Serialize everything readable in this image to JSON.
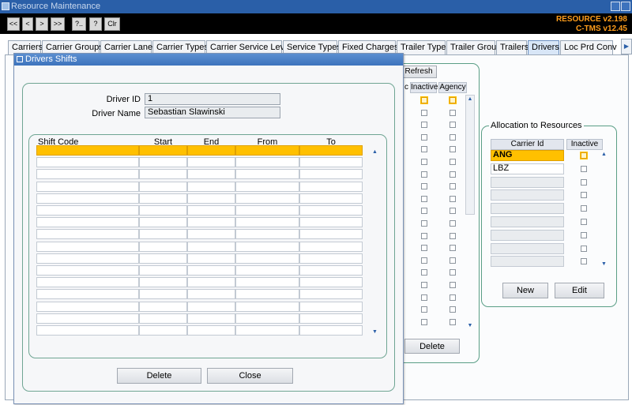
{
  "window": {
    "title": "Resource Maintenance"
  },
  "toolbar": {
    "buttons": [
      {
        "label": "<<",
        "name": "first-record-button"
      },
      {
        "label": "<",
        "name": "previous-record-button"
      },
      {
        "label": ">",
        "name": "next-record-button"
      },
      {
        "label": ">>",
        "name": "last-record-button"
      },
      {
        "label": "?..",
        "name": "query-button"
      },
      {
        "label": "?",
        "name": "help-button"
      },
      {
        "label": "Clr",
        "name": "clear-button"
      }
    ],
    "version_line1": "RESOURCE v2.198",
    "version_line2": "C-TMS v12.45"
  },
  "tabs": [
    {
      "label": "Carriers"
    },
    {
      "label": "Carrier Groups"
    },
    {
      "label": "Carrier Lanes"
    },
    {
      "label": "Carrier Types"
    },
    {
      "label": "Carrier Service Level"
    },
    {
      "label": "Service Types"
    },
    {
      "label": "Fixed Charges"
    },
    {
      "label": "Trailer Types"
    },
    {
      "label": "Trailer Group"
    },
    {
      "label": "Trailers"
    },
    {
      "label": "Drivers",
      "active": true
    },
    {
      "label": "Loc Prd Conv"
    }
  ],
  "drivers_panel": {
    "refresh_label": "Refresh",
    "col_partial": "c",
    "col_inactive": "Inactive",
    "col_agency": "Agency",
    "delete_label": "Delete"
  },
  "allocation": {
    "title": "Allocation to Resources",
    "col_carrier": "Carrier Id",
    "col_inactive": "Inactive",
    "rows": [
      "ANG",
      "LBZ",
      "",
      "",
      "",
      "",
      "",
      "",
      ""
    ],
    "new_label": "New",
    "edit_label": "Edit"
  },
  "dialog": {
    "title": "Drivers Shifts",
    "driver_id_label": "Driver ID",
    "driver_id_value": "1",
    "driver_name_label": "Driver Name",
    "driver_name_value": "Sebastian Slawinski",
    "columns": [
      "Shift Code",
      "Start",
      "End",
      "From",
      "To"
    ],
    "delete_label": "Delete",
    "close_label": "Close"
  }
}
